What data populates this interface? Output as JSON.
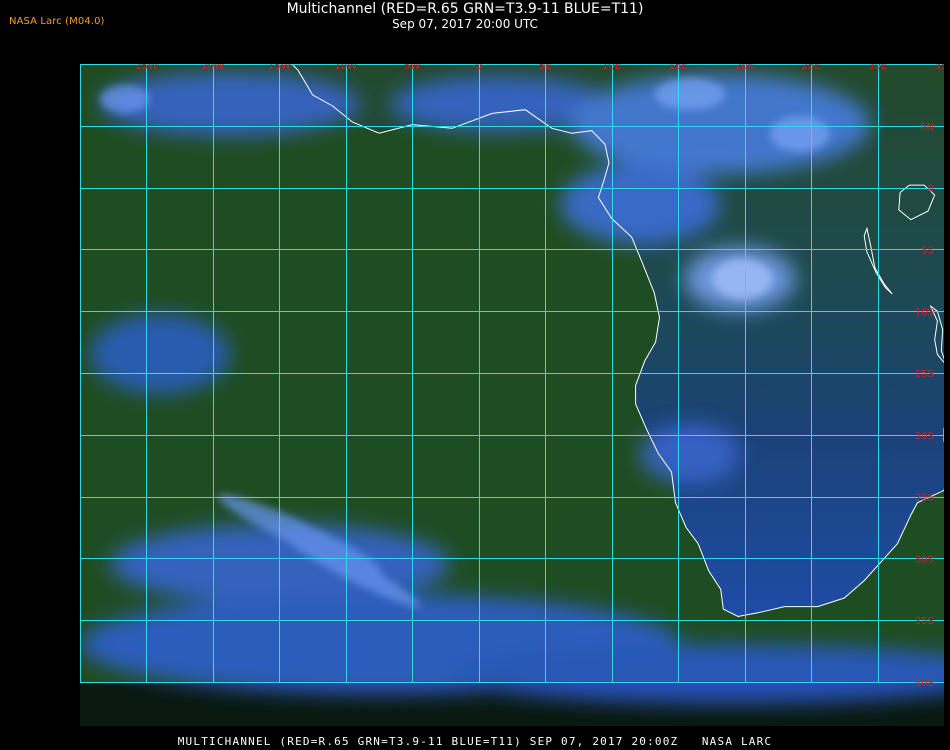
{
  "header": {
    "credit": "NASA Larc (M04.0)",
    "title": "Multichannel (RED=R.65 GRN=T3.9-11 BLUE=T11)",
    "subtitle": "Sep 07, 2017 20:00 UTC"
  },
  "footer": {
    "caption": "MULTICHANNEL (RED=R.65 GRN=T3.9-11 BLUE=T11) SEP 07, 2017 20:00Z   NASA LARC"
  },
  "map": {
    "projection": "equirectangular",
    "lon_range": [
      -30,
      35
    ],
    "lat_range": [
      -40,
      10
    ],
    "grid_step_deg": 5,
    "lon_labels": [
      "25W",
      "20W",
      "15W",
      "10W",
      "5W",
      "0",
      "5E",
      "10E",
      "15E",
      "20E",
      "25E",
      "30E",
      "35E"
    ],
    "lat_labels": [
      "5N",
      "0",
      "5S",
      "10S",
      "15S",
      "20S",
      "25S",
      "30S",
      "35S",
      "40S"
    ],
    "colors": {
      "grid": "#33d9e6",
      "labels": "#cc2222",
      "coastline": "#ffffff",
      "ocean": "#1a4a6a",
      "land": "#1e4a20",
      "cloud": "#4a7ee8"
    }
  }
}
